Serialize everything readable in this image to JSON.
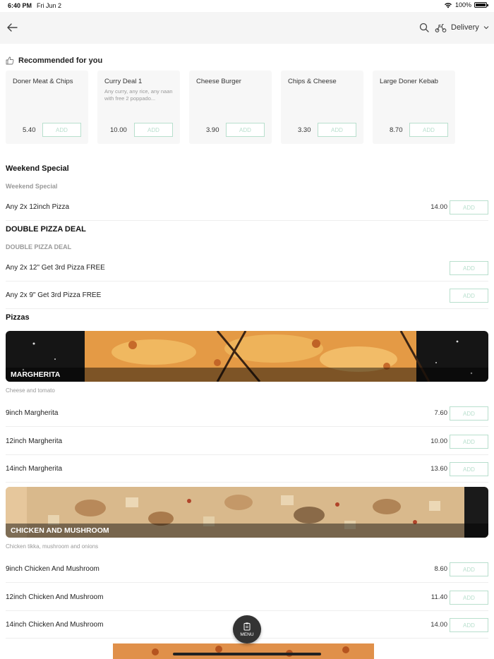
{
  "status": {
    "time": "6:40 PM",
    "date": "Fri Jun 2",
    "battery": "100%"
  },
  "header": {
    "delivery_label": "Delivery"
  },
  "recommended": {
    "title": "Recommended for you",
    "items": [
      {
        "name": "Doner Meat & Chips",
        "desc": "",
        "price": "5.40",
        "add": "ADD"
      },
      {
        "name": "Curry Deal 1",
        "desc": "Any curry, any rice, any naan with free 2 poppado...",
        "price": "10.00",
        "add": "ADD"
      },
      {
        "name": "Cheese Burger",
        "desc": "",
        "price": "3.90",
        "add": "ADD"
      },
      {
        "name": "Chips & Cheese",
        "desc": "",
        "price": "3.30",
        "add": "ADD"
      },
      {
        "name": "Large Doner Kebab",
        "desc": "",
        "price": "8.70",
        "add": "ADD"
      }
    ]
  },
  "weekend": {
    "title": "Weekend Special",
    "subtitle": "Weekend Special",
    "items": [
      {
        "name": "Any 2x 12inch Pizza",
        "price": "14.00",
        "add": "ADD"
      }
    ]
  },
  "double": {
    "title": "DOUBLE PIZZA DEAL",
    "subtitle": "DOUBLE PIZZA DEAL",
    "items": [
      {
        "name": "Any 2x 12\" Get 3rd Pizza FREE",
        "price": "",
        "add": "ADD"
      },
      {
        "name": "Any 2x 9\" Get 3rd Pizza FREE",
        "price": "",
        "add": "ADD"
      }
    ]
  },
  "pizzas": {
    "title": "Pizzas",
    "margherita": {
      "banner": "MARGHERITA",
      "desc": "Cheese and tomato",
      "items": [
        {
          "name": "9inch Margherita",
          "price": "7.60",
          "add": "ADD"
        },
        {
          "name": "12inch Margherita",
          "price": "10.00",
          "add": "ADD"
        },
        {
          "name": "14inch Margherita",
          "price": "13.60",
          "add": "ADD"
        }
      ]
    },
    "chicken": {
      "banner": "CHICKEN AND MUSHROOM",
      "desc": "Chicken tikka, mushroom and onions",
      "items": [
        {
          "name": "9inch Chicken And Mushroom",
          "price": "8.60",
          "add": "ADD"
        },
        {
          "name": "12inch Chicken And Mushroom",
          "price": "11.40",
          "add": "ADD"
        },
        {
          "name": "14inch Chicken And Mushroom",
          "price": "14.00",
          "add": "ADD"
        }
      ]
    }
  },
  "fab": {
    "label": "MENU"
  },
  "colors": {
    "accent": "#b8dfcd",
    "header_bg": "#f5f5f5",
    "card_bg": "#f7f7f7",
    "fab_bg": "#333333"
  },
  "icons": [
    "back-arrow-icon",
    "search-icon",
    "scooter-icon",
    "chevron-down-icon",
    "thumbs-up-icon",
    "menu-list-icon",
    "wifi-icon",
    "battery-icon"
  ]
}
